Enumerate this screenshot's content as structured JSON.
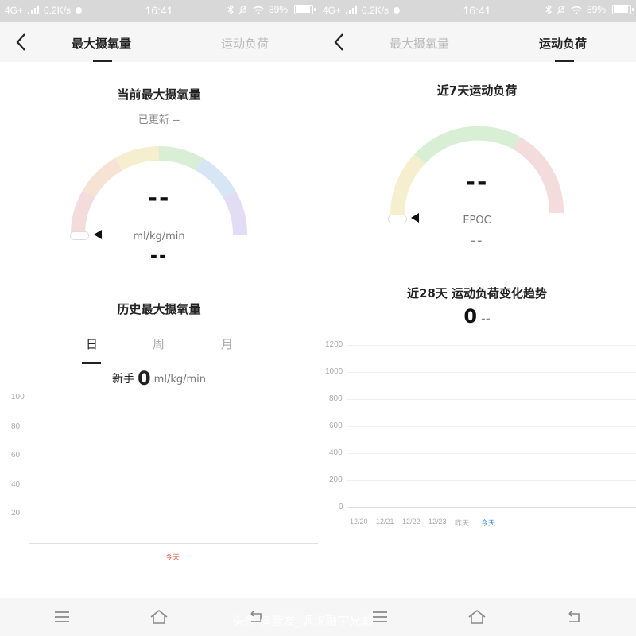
{
  "status_bar": {
    "network": "4G+",
    "speed": "0.2K/s",
    "time": "16:41",
    "battery": "89%"
  },
  "left": {
    "tabs": [
      {
        "label": "最大摄氧量"
      },
      {
        "label": "运动负荷"
      }
    ],
    "gauge_title": "当前最大摄氧量",
    "updated": "已更新 --",
    "gauge_value": "--",
    "gauge_unit": "ml/kg/min",
    "gauge_sub_value": "--",
    "history_title": "历史最大摄氧量",
    "period_tabs": [
      {
        "label": "日"
      },
      {
        "label": "周"
      },
      {
        "label": "月"
      }
    ],
    "level": {
      "label": "新手",
      "value": "0",
      "unit": "ml/kg/min"
    },
    "chart_data": {
      "type": "line",
      "title": "",
      "yticks": [
        100,
        80,
        60,
        40,
        20
      ],
      "ylim": [
        0,
        100
      ],
      "categories": [
        "今天"
      ],
      "series": []
    }
  },
  "right": {
    "tabs": [
      {
        "label": "最大摄氧量"
      },
      {
        "label": "运动负荷"
      }
    ],
    "gauge_title": "近7天运动负荷",
    "gauge_value": "--",
    "gauge_unit": "EPOC",
    "gauge_sub_value": "--",
    "trend_title": "近28天 运动负荷变化趋势",
    "trend_value": "0",
    "trend_suffix": "--",
    "chart_data": {
      "type": "bar",
      "title": "",
      "yticks": [
        1200,
        1000,
        800,
        600,
        400,
        200,
        0
      ],
      "ylim": [
        0,
        1200
      ],
      "categories": [
        "12/20",
        "12/21",
        "12/22",
        "12/23",
        "昨天",
        "今天"
      ],
      "values": [
        0,
        0,
        0,
        0,
        0,
        0
      ]
    }
  },
  "watermark": "头条 @智友_调询融宇光邮"
}
